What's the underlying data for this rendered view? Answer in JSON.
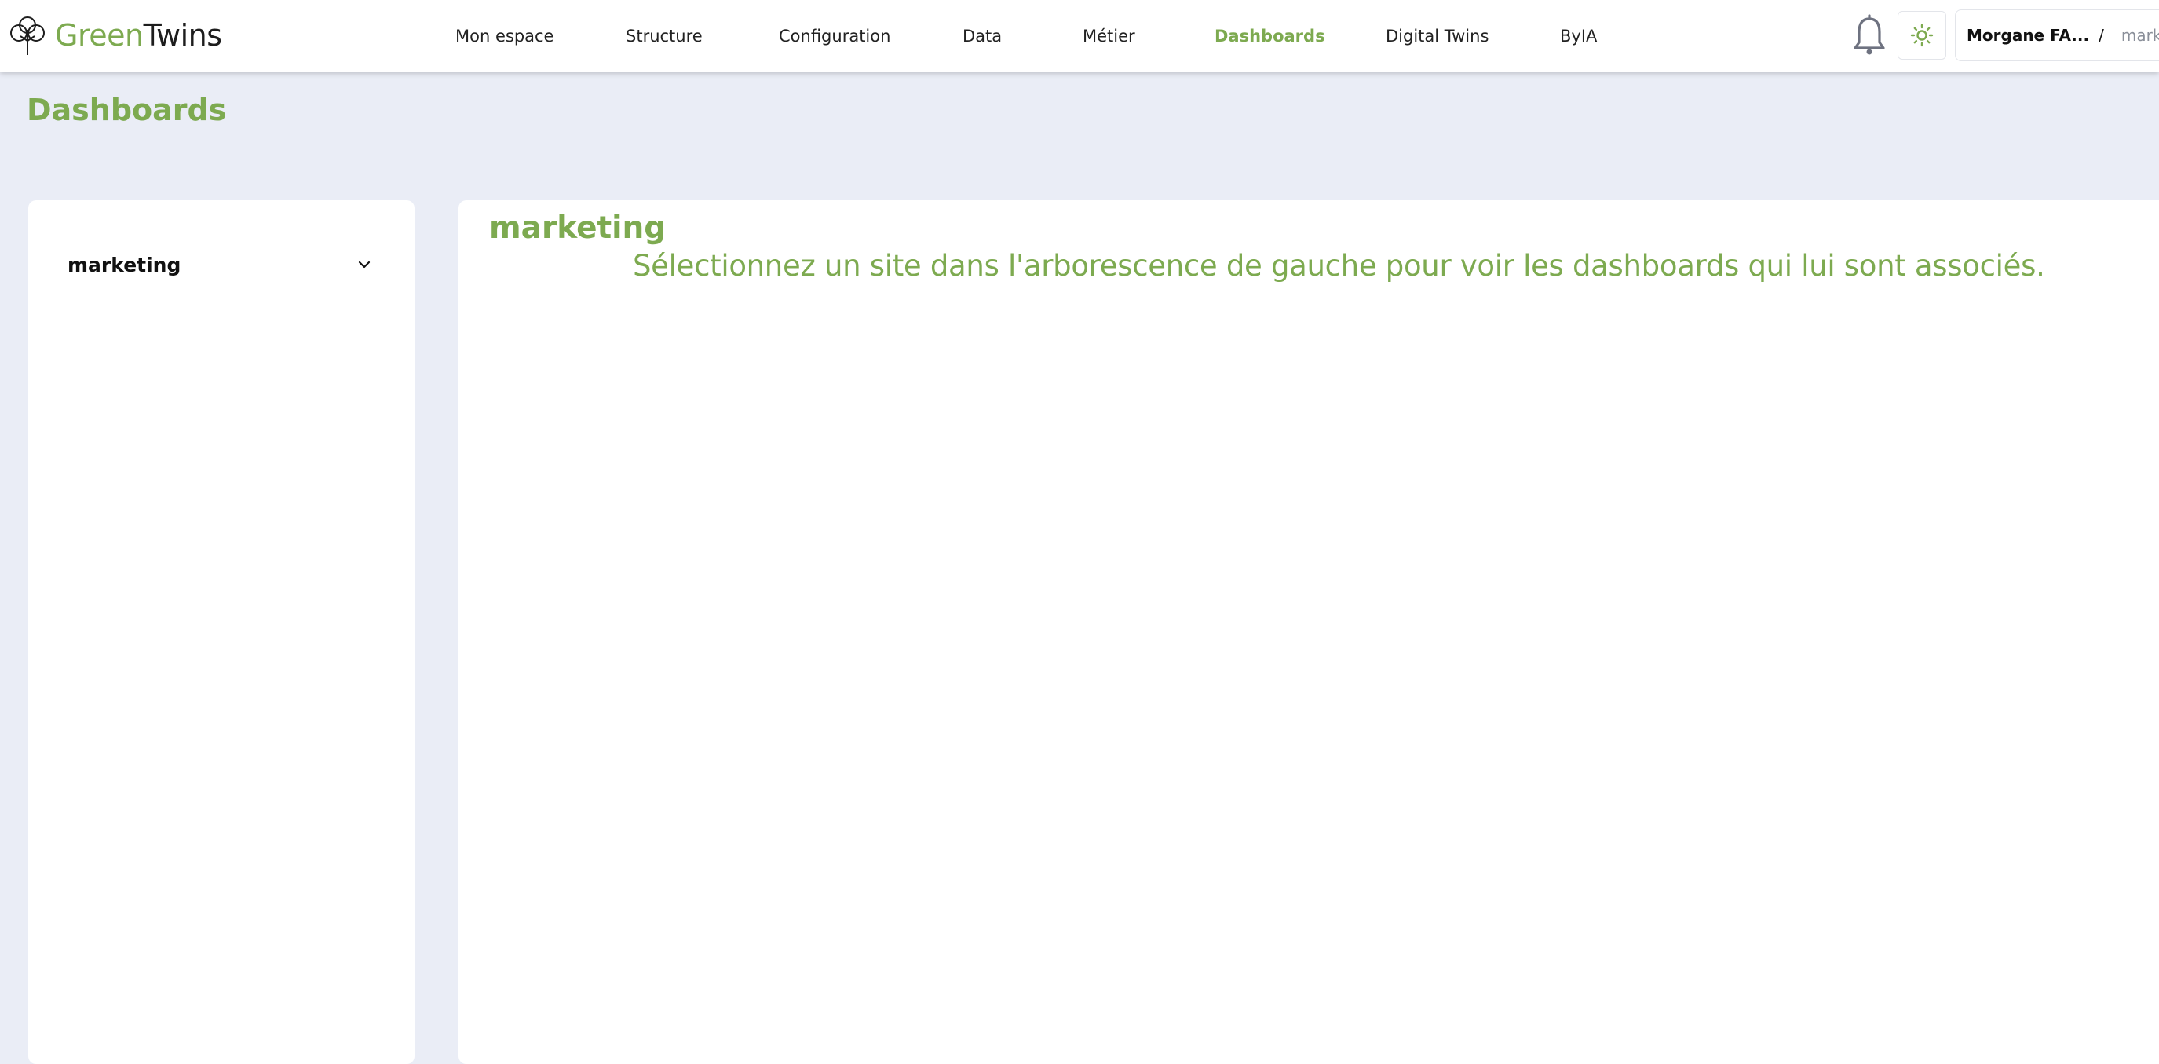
{
  "brand": {
    "name_part1": "Green",
    "name_part2": "Twins",
    "accent_color": "#7daa50"
  },
  "nav": {
    "items": [
      {
        "label": "Mon espace",
        "active": false
      },
      {
        "label": "Structure",
        "active": false
      },
      {
        "label": "Configuration",
        "active": false
      },
      {
        "label": "Data",
        "active": false
      },
      {
        "label": "Métier",
        "active": false
      },
      {
        "label": "Dashboards",
        "active": true
      },
      {
        "label": "Digital Twins",
        "active": false
      },
      {
        "label": "ByIA",
        "active": false
      }
    ]
  },
  "header": {
    "icons": [
      "bell-icon",
      "sun-icon"
    ],
    "user_name": "Morgane FA...",
    "separator": "/",
    "organization": "marketing"
  },
  "page": {
    "title": "Dashboards"
  },
  "sidebar": {
    "tree": [
      {
        "label": "marketing",
        "icon": "chevron-down-icon"
      }
    ]
  },
  "main": {
    "title": "marketing",
    "message": "Sélectionnez un site dans l'arborescence de gauche pour voir les dashboards qui lui sont associés."
  }
}
